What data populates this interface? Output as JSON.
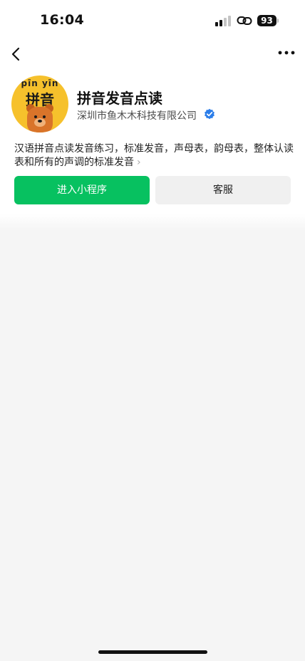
{
  "status_bar": {
    "time": "16:04",
    "battery": "93"
  },
  "icons": {
    "back": "chevron-left-icon",
    "more": "more-dots-icon",
    "verified": "verified-check-icon",
    "signal": "signal-icon",
    "link": "link-icon"
  },
  "app": {
    "logo_pinyin": "pīn yīn",
    "logo_chars": "拼音",
    "name": "拼音发音点读",
    "company": "深圳市鱼木木科技有限公司",
    "description": "汉语拼音点读发音练习，标准发音，声母表，韵母表，整体认读表和所有的声调的标准发音",
    "description_chevron": "›"
  },
  "buttons": {
    "enter": "进入小程序",
    "service": "客服"
  },
  "colors": {
    "primary": "#07c160",
    "secondary_bg": "#f0f0f0",
    "verified": "#2b7de9",
    "logo_bg": "#f6c12c",
    "page_bg": "#f5f5f5"
  }
}
